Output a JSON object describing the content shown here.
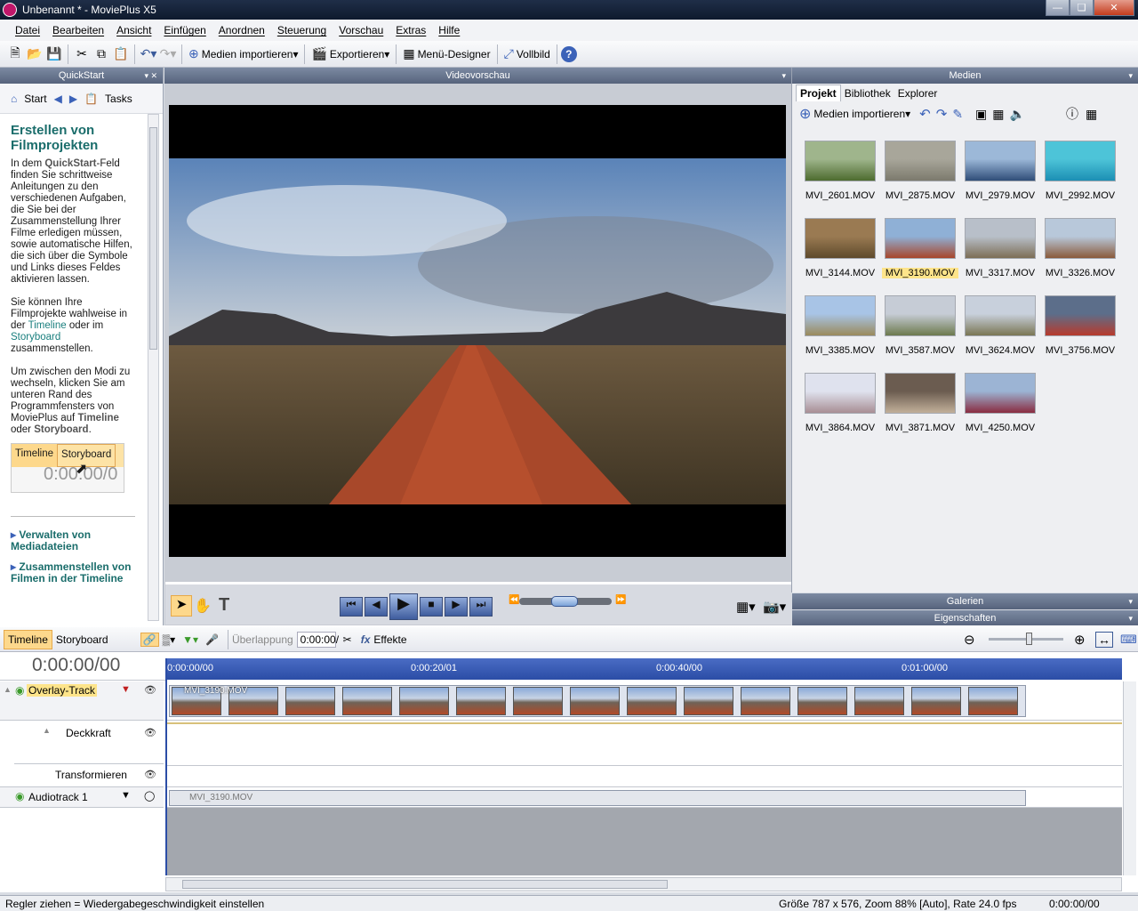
{
  "window": {
    "title": "Unbenannt * - MoviePlus X5"
  },
  "menu": [
    "Datei",
    "Bearbeiten",
    "Ansicht",
    "Einfügen",
    "Anordnen",
    "Steuerung",
    "Vorschau",
    "Extras",
    "Hilfe"
  ],
  "toolbar": {
    "import_label": "Medien importieren",
    "export_label": "Exportieren",
    "menu_designer_label": "Menü-Designer",
    "fullscreen_label": "Vollbild"
  },
  "quickstart": {
    "header": "QuickStart",
    "nav": {
      "start": "Start",
      "tasks": "Tasks"
    },
    "heading": "Erstellen von Filmprojekten",
    "p1_a": "In dem ",
    "p1_b": "QuickStart",
    "p1_c": "-Feld finden Sie schrittweise Anleitungen zu den verschiedenen Aufgaben, die Sie bei der Zusammenstellung Ihrer Filme erledigen müssen, sowie automatische Hilfen, die sich über die Symbole und Links dieses Feldes aktivieren lassen.",
    "p2_a": "Sie können Ihre Filmprojekte wahlweise in der ",
    "p2_b": "Timeline",
    "p2_c": " oder im ",
    "p2_d": "Storyboard",
    "p2_e": " zusammenstellen.",
    "p3_a": "Um zwischen den Modi zu wechseln, klicken Sie am unteren Rand des Programmfensters von MoviePlus auf ",
    "p3_b": "Timeline",
    "p3_c": " oder ",
    "p3_d": "Storyboard",
    "p3_e": ".",
    "demo": {
      "timeline": "Timeline",
      "storyboard": "Storyboard",
      "time": "0:00:00/0"
    },
    "link1": "Verwalten von Mediadateien",
    "link2": "Zusammenstellen von Filmen in der Timeline"
  },
  "preview": {
    "header": "Videovorschau"
  },
  "media": {
    "header": "Medien",
    "tabs": [
      "Projekt",
      "Bibliothek",
      "Explorer"
    ],
    "import_label": "Medien importieren",
    "items": [
      {
        "name": "MVI_2601.MOV",
        "c1": "#9fb58c",
        "c2": "#4d6b2f"
      },
      {
        "name": "MVI_2875.MOV",
        "c1": "#a8a69a",
        "c2": "#7c7a6d"
      },
      {
        "name": "MVI_2979.MOV",
        "c1": "#9cb8d8",
        "c2": "#2f4d78"
      },
      {
        "name": "MVI_2992.MOV",
        "c1": "#4dc4d8",
        "c2": "#1c8fb4"
      },
      {
        "name": "MVI_3144.MOV",
        "c1": "#9a7a52",
        "c2": "#5e4a2c"
      },
      {
        "name": "MVI_3190.MOV",
        "c1": "#8fb0d6",
        "c2": "#a8462a",
        "selected": true
      },
      {
        "name": "MVI_3317.MOV",
        "c1": "#b8bfc9",
        "c2": "#7c6e56"
      },
      {
        "name": "MVI_3326.MOV",
        "c1": "#b8c8da",
        "c2": "#8a5a3a"
      },
      {
        "name": "MVI_3385.MOV",
        "c1": "#a8c4e6",
        "c2": "#9a8a5c"
      },
      {
        "name": "MVI_3587.MOV",
        "c1": "#c6ccd6",
        "c2": "#6d7a4e"
      },
      {
        "name": "MVI_3624.MOV",
        "c1": "#c8d0dc",
        "c2": "#7a7654"
      },
      {
        "name": "MVI_3756.MOV",
        "c1": "#5c6e8a",
        "c2": "#b83a2c"
      },
      {
        "name": "MVI_3864.MOV",
        "c1": "#dfe2ee",
        "c2": "#a88e94"
      },
      {
        "name": "MVI_3871.MOV",
        "c1": "#6b5c50",
        "c2": "#c2b09a"
      },
      {
        "name": "MVI_4250.MOV",
        "c1": "#9cb4d4",
        "c2": "#8a2c40"
      }
    ],
    "galleries": "Galerien",
    "properties": "Eigenschaften"
  },
  "timeline": {
    "mode_timeline": "Timeline",
    "mode_storyboard": "Storyboard",
    "overlap_label": "Überlappung",
    "overlap_value": "0:00:00/",
    "effects_label": "Effekte",
    "time": "0:00:00/00",
    "ruler": [
      "0:00:00/00",
      "0:00:20/01",
      "0:00:40/00",
      "0:01:00/00"
    ],
    "overlay_track": "Overlay-Track",
    "opacity": "Deckkraft",
    "transform": "Transformieren",
    "audio_track": "Audiotrack 1",
    "clip_name": "MVI_3190.MOV"
  },
  "status": {
    "hint": "Regler ziehen = Wiedergabegeschwindigkeit einstellen",
    "info": "Größe 787 x 576, Zoom 88% [Auto], Rate 24.0 fps",
    "time": "0:00:00/00"
  }
}
